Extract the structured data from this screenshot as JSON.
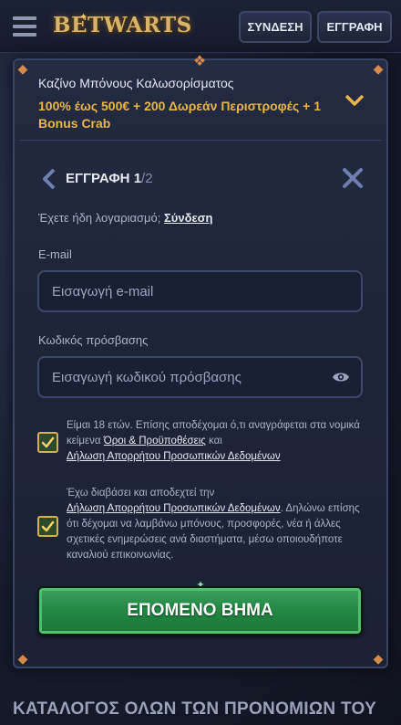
{
  "header": {
    "logo_text": "BETWARTS",
    "login_label": "ΣΥΝΔΕΣΗ",
    "register_label": "ΕΓΓΡΑΦΗ"
  },
  "bonus": {
    "title": "Καζίνο Μπόνους Καλωσορίσματος",
    "offer": "100% έως 500€ + 200 Δωρεάν Περιστροφές + 1 Bonus Crab"
  },
  "form": {
    "title": "ΕΓΓΡΑΦΗ",
    "step": "1",
    "total": "/2",
    "have_account_text": "Έχετε ήδη λογαριασμό;",
    "login_link": "Σύνδεση",
    "email_label": "E-mail",
    "email_placeholder": "Εισαγωγή e-mail",
    "password_label": "Κωδικός πρόσβασης",
    "password_placeholder": "Εισαγωγή κωδικού πρόσβασης",
    "terms_text": "Είμαι 18 ετών. Επίσης αποδέχομαι ό,τι αναγράφεται στα νομικά κείμενα",
    "terms_link": "Όροι & Προϋποθέσεις",
    "terms_and": "και",
    "privacy_link": "Δήλωση Απορρήτου Προσωπικών Δεδομένων",
    "marketing_prefix": "Έχω διαβάσει και αποδεχτεί την",
    "marketing_link": "Δήλωση Απορρήτου Προσωπικών Δεδομένων",
    "marketing_suffix": ". Δηλώνω επίσης ότι δέχομαι να λαμβάνω μπόνους, προσφορές, νέα ή άλλες σχετικές ενημερώσεις ανά διαστήματα, μέσω οποιουδήποτε καναλιού επικοινωνίας.",
    "terms_checked": true,
    "marketing_checked": true,
    "submit_label": "ΕΠΟΜΕΝΟ ΒΗΜΑ"
  },
  "footer": {
    "title": "ΚΑΤΑΛΟΓΟΣ ΟΛΩΝ ΤΩΝ ΠΡΟΝΟΜΙΩΝ ΤΟΥ"
  },
  "colors": {
    "accent_gold": "#e8b547",
    "cta_green": "#238a44",
    "frame_border": "#3a4464"
  }
}
